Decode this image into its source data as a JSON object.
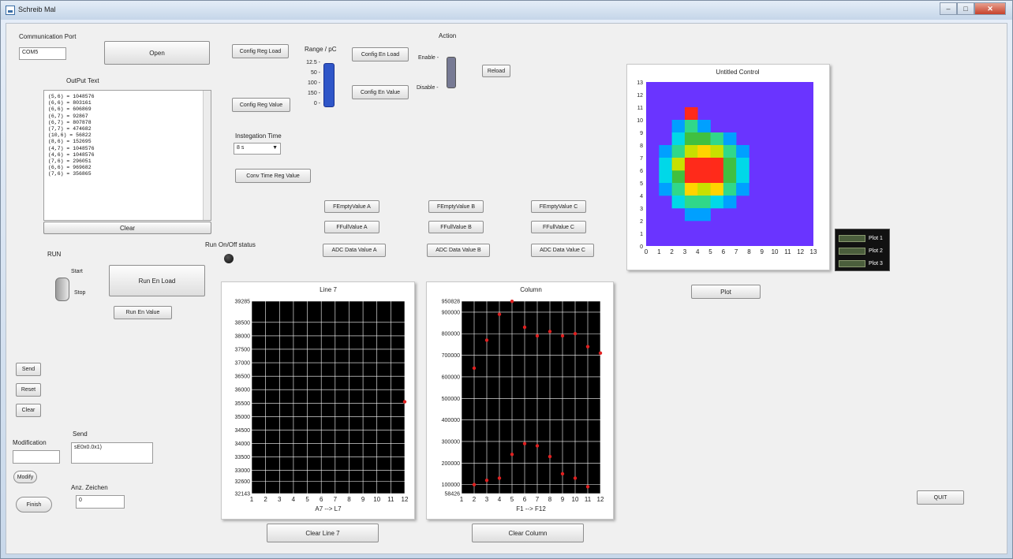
{
  "window": {
    "title": "Schreib Mal",
    "buttons": {
      "minimize": "–",
      "maximize": "□",
      "close": "✕"
    }
  },
  "comm": {
    "label": "Communication Port",
    "value": "COM5",
    "open_label": "Open"
  },
  "output": {
    "label": "OutPut Text",
    "lines": [
      "(5,6) = 1048576",
      "(6,6) = 803161",
      "(6,6) = 606869",
      "(6,7) = 92867",
      "(6,7) = 807878",
      "(7,7) = 474682",
      "(10,6) = 56822",
      "(8,6) = 152695",
      "(4,7) = 1048576",
      "(4,6) = 1048576",
      "(7,6) = 296051",
      "(6,6) = 969682",
      "(7,6) = 356865"
    ],
    "clear_label": "Clear"
  },
  "config": {
    "reg_load": "Config Reg Load",
    "reg_value": "Config Reg Value",
    "en_load": "Config En Load",
    "en_value": "Config En Value",
    "range_label": "Range / pC",
    "range_ticks": [
      "12.5 -",
      "50 -",
      "100 -",
      "150 -",
      "0 -"
    ],
    "integration_label": "Instegation Time",
    "integration_value": "8 s",
    "conv_time_label": "Conv Time Reg Value"
  },
  "action": {
    "label": "Action",
    "enable_label": "Enable -",
    "disable_label": "Disable -",
    "reload_label": "Reload"
  },
  "ff": {
    "empty": [
      "FEmptyValue A",
      "FEmptyValue B",
      "FEmptyValue C"
    ],
    "full": [
      "FFullValue A",
      "FFullValue B",
      "FFullValue C"
    ],
    "adc": [
      "ADC Data Value A",
      "ADC Data Value B",
      "ADC Data Value C"
    ]
  },
  "run": {
    "label": "RUN",
    "start_label": "Start",
    "stop_label": "Stop",
    "en_load": "Run En Load",
    "en_value": "Run En Value",
    "status_label": "Run On/Off status"
  },
  "side_buttons": {
    "send": "Send",
    "reset": "Reset",
    "clear": "Clear"
  },
  "modification": {
    "label": "Modification",
    "value": "",
    "modify_label": "Modify",
    "finish_label": "Finish"
  },
  "send_box": {
    "label": "Send",
    "value": "sE0x0.0x1)"
  },
  "anz_zeichen": {
    "label": "Anz. Zeichen",
    "value": "0"
  },
  "buttons": {
    "clear_line": "Clear Line 7",
    "clear_column": "Clear Column",
    "plot": "Plot",
    "quit": "QUIT"
  },
  "colors": {
    "plot_bg": "#000000",
    "plot_grid": "#ffffff",
    "heat_bg": "#6a34ff",
    "point": "#e02020"
  },
  "chart_data": [
    {
      "type": "heatmap",
      "title": "Untitled Control",
      "x_ticks": [
        "0",
        "1",
        "2",
        "3",
        "4",
        "5",
        "6",
        "7",
        "8",
        "9",
        "10",
        "11",
        "12",
        "13"
      ],
      "y_ticks": [
        "0",
        "1",
        "2",
        "3",
        "4",
        "5",
        "6",
        "7",
        "8",
        "9",
        "10",
        "11",
        "12",
        "13"
      ],
      "xlim": [
        0,
        13
      ],
      "ylim": [
        0,
        13
      ],
      "cells": [
        {
          "x": 3,
          "y": 10,
          "v": 9
        },
        {
          "x": 2,
          "y": 9,
          "v": 2
        },
        {
          "x": 3,
          "y": 9,
          "v": 4
        },
        {
          "x": 4,
          "y": 9,
          "v": 2
        },
        {
          "x": 2,
          "y": 8,
          "v": 3
        },
        {
          "x": 3,
          "y": 8,
          "v": 5
        },
        {
          "x": 4,
          "y": 8,
          "v": 5
        },
        {
          "x": 5,
          "y": 8,
          "v": 4
        },
        {
          "x": 6,
          "y": 8,
          "v": 2
        },
        {
          "x": 1,
          "y": 7,
          "v": 2
        },
        {
          "x": 2,
          "y": 7,
          "v": 4
        },
        {
          "x": 3,
          "y": 7,
          "v": 6
        },
        {
          "x": 4,
          "y": 7,
          "v": 7
        },
        {
          "x": 5,
          "y": 7,
          "v": 6
        },
        {
          "x": 6,
          "y": 7,
          "v": 4
        },
        {
          "x": 7,
          "y": 7,
          "v": 2
        },
        {
          "x": 1,
          "y": 6,
          "v": 3
        },
        {
          "x": 2,
          "y": 5,
          "v": 5
        },
        {
          "x": 2,
          "y": 6,
          "v": 6
        },
        {
          "x": 3,
          "y": 6,
          "v": 9
        },
        {
          "x": 4,
          "y": 6,
          "v": 9
        },
        {
          "x": 5,
          "y": 6,
          "v": 9
        },
        {
          "x": 6,
          "y": 6,
          "v": 5
        },
        {
          "x": 7,
          "y": 6,
          "v": 3
        },
        {
          "x": 1,
          "y": 5,
          "v": 3
        },
        {
          "x": 3,
          "y": 5,
          "v": 9
        },
        {
          "x": 4,
          "y": 5,
          "v": 9
        },
        {
          "x": 5,
          "y": 5,
          "v": 9
        },
        {
          "x": 6,
          "y": 5,
          "v": 5
        },
        {
          "x": 7,
          "y": 5,
          "v": 3
        },
        {
          "x": 1,
          "y": 4,
          "v": 2
        },
        {
          "x": 2,
          "y": 4,
          "v": 4
        },
        {
          "x": 3,
          "y": 4,
          "v": 7
        },
        {
          "x": 4,
          "y": 4,
          "v": 6
        },
        {
          "x": 5,
          "y": 4,
          "v": 7
        },
        {
          "x": 6,
          "y": 4,
          "v": 4
        },
        {
          "x": 7,
          "y": 4,
          "v": 2
        },
        {
          "x": 2,
          "y": 3,
          "v": 3
        },
        {
          "x": 3,
          "y": 3,
          "v": 4
        },
        {
          "x": 4,
          "y": 3,
          "v": 4
        },
        {
          "x": 5,
          "y": 3,
          "v": 3
        },
        {
          "x": 6,
          "y": 3,
          "v": 2
        },
        {
          "x": 3,
          "y": 2,
          "v": 2
        },
        {
          "x": 4,
          "y": 2,
          "v": 2
        }
      ]
    },
    {
      "type": "scatter",
      "title": "Line 7",
      "xlabel": "A7 --> L7",
      "ylabel": "",
      "x_ticks": [
        "1",
        "2",
        "3",
        "4",
        "5",
        "6",
        "7",
        "8",
        "9",
        "10",
        "11",
        "12"
      ],
      "y_ticks": [
        "32143",
        "32600",
        "33000",
        "33500",
        "34000",
        "34500",
        "35000",
        "35500",
        "36000",
        "36500",
        "37000",
        "37500",
        "38000",
        "38500",
        "39285"
      ],
      "xlim": [
        1,
        12
      ],
      "ylim": [
        32143,
        39285
      ],
      "series": [
        {
          "values": [
            {
              "x": 12,
              "y": 35550
            }
          ]
        }
      ]
    },
    {
      "type": "scatter",
      "title": "Column",
      "xlabel": "F1 --> F12",
      "ylabel": "",
      "x_ticks": [
        "1",
        "2",
        "3",
        "4",
        "5",
        "6",
        "7",
        "8",
        "9",
        "10",
        "11",
        "12"
      ],
      "y_ticks": [
        "58426",
        "100000",
        "200000",
        "300000",
        "400000",
        "500000",
        "600000",
        "700000",
        "800000",
        "900000",
        "950828"
      ],
      "xlim": [
        1,
        12
      ],
      "ylim": [
        58426,
        950828
      ],
      "series": [
        {
          "values": [
            {
              "x": 2,
              "y": 640000
            },
            {
              "x": 3,
              "y": 770000
            },
            {
              "x": 4,
              "y": 890000
            },
            {
              "x": 5,
              "y": 950000
            },
            {
              "x": 6,
              "y": 830000
            },
            {
              "x": 7,
              "y": 790000
            },
            {
              "x": 8,
              "y": 810000
            },
            {
              "x": 9,
              "y": 790000
            },
            {
              "x": 10,
              "y": 800000
            },
            {
              "x": 11,
              "y": 740000
            },
            {
              "x": 12,
              "y": 710000
            },
            {
              "x": 2,
              "y": 100000
            },
            {
              "x": 3,
              "y": 120000
            },
            {
              "x": 4,
              "y": 130000
            },
            {
              "x": 5,
              "y": 240000
            },
            {
              "x": 6,
              "y": 290000
            },
            {
              "x": 7,
              "y": 280000
            },
            {
              "x": 8,
              "y": 230000
            },
            {
              "x": 9,
              "y": 150000
            },
            {
              "x": 10,
              "y": 130000
            },
            {
              "x": 11,
              "y": 90000
            }
          ]
        }
      ]
    }
  ]
}
